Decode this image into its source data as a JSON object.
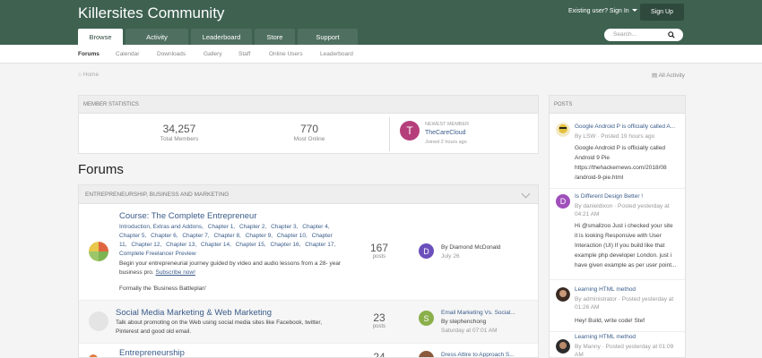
{
  "header": {
    "site_title": "Killersites Community",
    "signin": "Existing user? Sign In",
    "signup": "Sign Up",
    "tabs": [
      "Browse",
      "Activity",
      "Leaderboard",
      "Store",
      "Support"
    ],
    "search_placeholder": "Search..."
  },
  "subnav": [
    "Forums",
    "Calendar",
    "Downloads",
    "Gallery",
    "Staff",
    "Online Users",
    "Leaderboard"
  ],
  "breadcrumb": "Home",
  "all_activity": "All Activity",
  "member_stats": {
    "heading": "MEMBER STATISTICS",
    "total_members": "34,257",
    "total_members_label": "Total Members",
    "most_online": "770",
    "most_online_label": "Most Online",
    "newest_label": "NEWEST MEMBER",
    "newest_initial": "T",
    "newest_name": "TheCareCloud",
    "newest_time": "Joined 2 hours ago"
  },
  "forums_heading": "Forums",
  "forum_category": "ENTREPRENEURSHIP, BUSINESS AND MARKETING",
  "forums": [
    {
      "title": "Course: The Complete Entrepreneur",
      "subforums": [
        "Introduction, Extras and Addons,",
        "Chapter 1,",
        "Chapter 2,",
        "Chapter 3,",
        "Chapter 4,",
        "Chapter 5,",
        "Chapter 6,",
        "Chapter 7,",
        "Chapter 8,",
        "Chapter 9,",
        "Chapter 10,",
        "Chapter 11,",
        "Chapter 12,",
        "Chapter 13,",
        "Chapter 14,",
        "Chapter 15,",
        "Chapter 16,",
        "Chapter 17,",
        "Complete Freelancer Preview"
      ],
      "desc_line1": "Begin your entrepreneurial journey guided by video and audio lessons from a 28-",
      "desc_line2": "year business pro.",
      "subscribe": "Subscribe now!",
      "desc_line3": "Formally the 'Business Battleplan'",
      "posts": "167",
      "posts_label": "posts",
      "last_initial": "D",
      "last_by": "By Diamond McDonald",
      "last_date": "July 26"
    },
    {
      "title": "Social Media Marketing & Web Marketing",
      "desc_line1": "Talk about promoting on the Web using social media sites like Facebook, twitter,",
      "desc_line2": "Pinterest and good old email.",
      "posts": "23",
      "posts_label": "posts",
      "last_initial": "S",
      "last_title": "Email Marketing Vs. Social...",
      "last_by": "By stephenchong",
      "last_date": "Saturday at 07:01 AM"
    },
    {
      "title": "Entrepreneurship",
      "posts": "24",
      "last_title": "Dress Attire to Approach S..."
    }
  ],
  "posts_sidebar": {
    "heading": "POSTS",
    "items": [
      {
        "title": "Google Android P is officially called A...",
        "meta": "By LSW · Posted 19 hours ago",
        "body": [
          "Google Android P is officially called",
          "Android 9 Pie",
          "https://thehackernews.com/2018/08",
          "/android-9-pie.html"
        ]
      },
      {
        "initial": "D",
        "title": "Is Different Design Better !",
        "meta1": "By danieldixon · Posted yesterday at",
        "meta2": "04:21 AM",
        "body": [
          "Hi @smallzoo Just i checked your site",
          "it is looking Responsive with User",
          "Interaction (UI) If you build like that",
          "example php developer London. just i",
          "have given example as per user point..."
        ]
      },
      {
        "title": "Learning HTML method",
        "meta1": "By administrator · Posted yesterday at",
        "meta2": "01:26 AM",
        "body": [
          "Hey! Build, write code! Stef"
        ]
      },
      {
        "title": "Learning HTML method",
        "meta1": "By Manny · Posted yesterday at 01:09",
        "meta2": "AM"
      }
    ]
  },
  "colors": {
    "header": "#3e6150",
    "link": "#3a5c8a",
    "newest_avatar": "#b43f7b",
    "avatar_d": "#6b4fbb",
    "avatar_s": "#8bb04a",
    "avatar_d2": "#a04fbb"
  }
}
